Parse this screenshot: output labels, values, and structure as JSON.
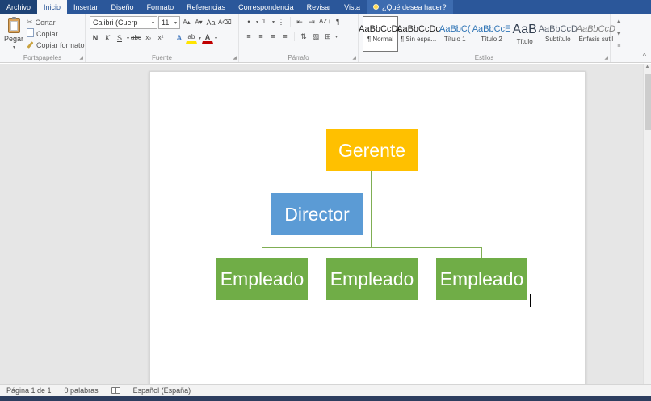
{
  "tabs": {
    "items": [
      "Archivo",
      "Inicio",
      "Insertar",
      "Diseño",
      "Formato",
      "Referencias",
      "Correspondencia",
      "Revisar",
      "Vista"
    ],
    "search_label": "¿Qué desea hacer?"
  },
  "ribbon": {
    "clipboard": {
      "group_label": "Portapapeles",
      "paste": "Pegar",
      "cut": "Cortar",
      "copy": "Copiar",
      "format_painter": "Copiar formato"
    },
    "font": {
      "group_label": "Fuente",
      "family": "Calibri (Cuerp",
      "size": "11",
      "bold": "N",
      "italic": "K",
      "underline": "S",
      "strikethrough": "abc",
      "subscript": "x₂",
      "superscript": "x²",
      "grow_font": "A▴",
      "shrink_font": "A▾",
      "change_case": "Aa",
      "clear_format": "A⌫",
      "text_effects": "A",
      "highlight": "ab",
      "font_color": "A"
    },
    "paragraph": {
      "group_label": "Párrafo",
      "sort": "AZ↓",
      "pilcrow": "¶"
    },
    "styles": {
      "group_label": "Estilos",
      "items": [
        {
          "sample": "AaBbCcDc",
          "label": "¶ Normal"
        },
        {
          "sample": "AaBbCcDc",
          "label": "¶ Sin espa..."
        },
        {
          "sample": "AaBbC(",
          "label": "Título 1"
        },
        {
          "sample": "AaBbCcE",
          "label": "Título 2"
        },
        {
          "sample": "AaB",
          "label": "Título"
        },
        {
          "sample": "AaBbCcD",
          "label": "Subtítulo"
        },
        {
          "sample": "AaBbCcD",
          "label": "Énfasis sutil"
        }
      ]
    }
  },
  "icons": {
    "dropdown": "▾",
    "bullets": "•",
    "numbering": "1.",
    "multilevel": "⋮",
    "outdent": "⇤",
    "indent": "⇥",
    "align": "≡",
    "line_spacing": "⇅",
    "shading": "▨",
    "borders": "⊞",
    "launcher": "◢",
    "collapse": "^",
    "scroll_up": "▲",
    "gallery_up": "▲",
    "gallery_down": "▼",
    "gallery_more": "≡"
  },
  "document": {
    "org_chart": {
      "top": "Gerente",
      "middle": "Director",
      "children": [
        "Empleado",
        "Empleado",
        "Empleado"
      ],
      "colors": {
        "top": "#FFC000",
        "middle": "#5B9BD5",
        "children": "#70AD47",
        "connector": "#7fae53"
      }
    }
  },
  "status": {
    "page": "Página 1 de 1",
    "words": "0 palabras",
    "language": "Español (España)"
  }
}
